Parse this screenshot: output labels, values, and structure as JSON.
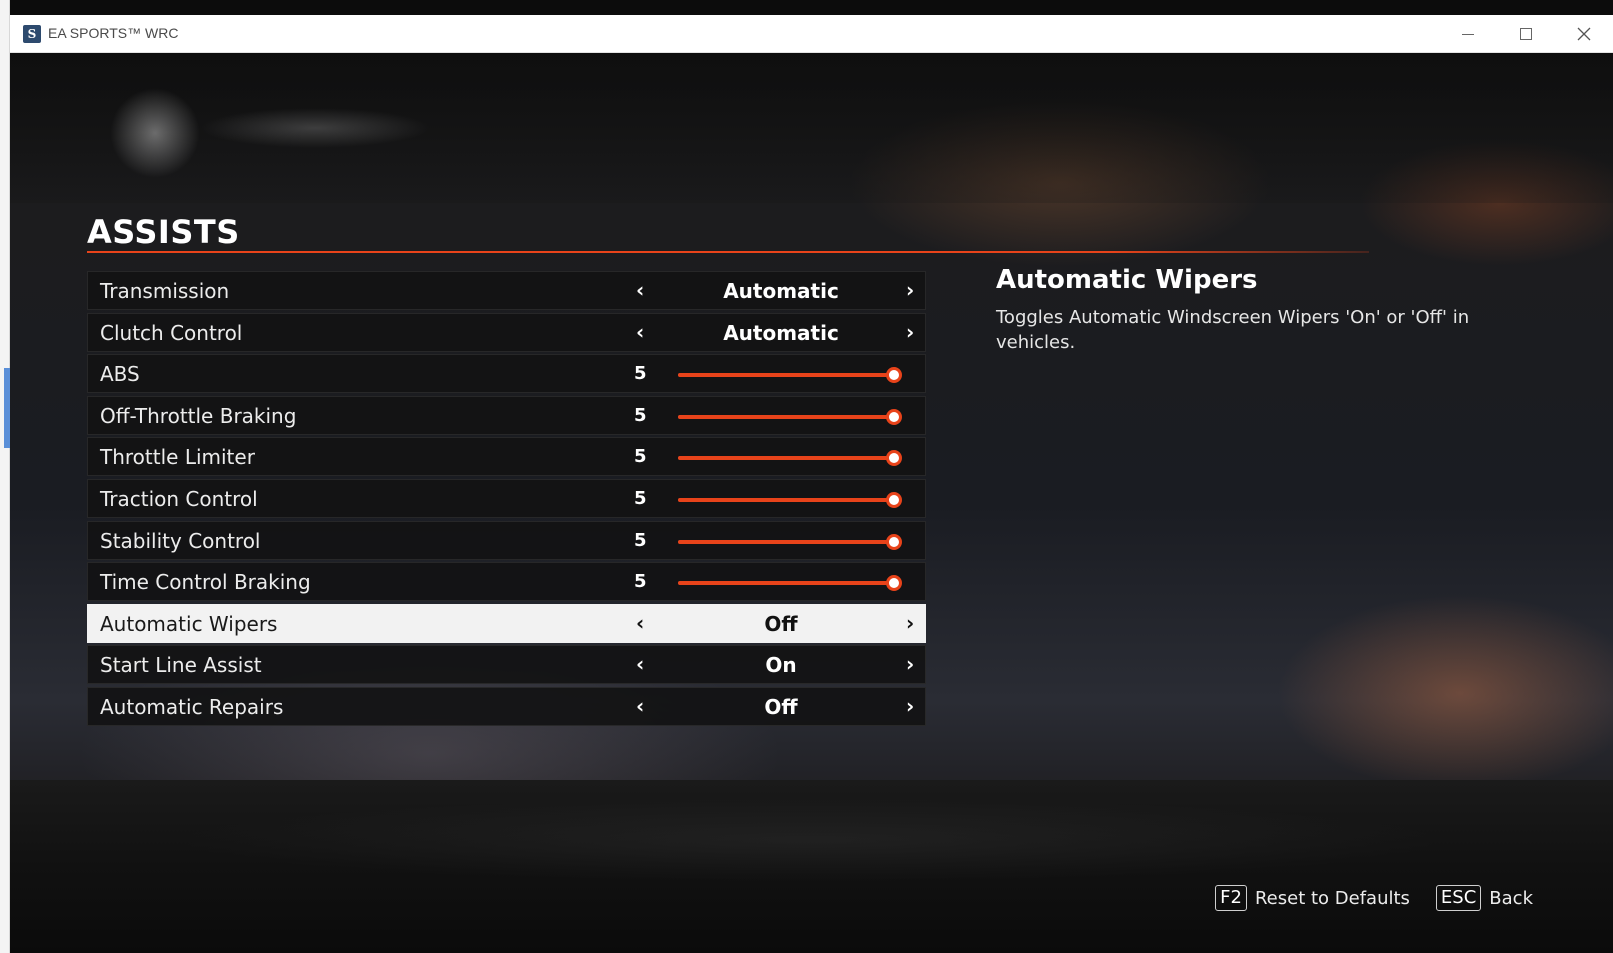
{
  "window": {
    "app_title": "EA SPORTS™ WRC"
  },
  "page": {
    "title": "ASSISTS"
  },
  "settings": [
    {
      "label": "Transmission",
      "kind": "option",
      "value": "Automatic"
    },
    {
      "label": "Clutch Control",
      "kind": "option",
      "value": "Automatic"
    },
    {
      "label": "ABS",
      "kind": "slider",
      "value": "5",
      "level": 1.0
    },
    {
      "label": "Off-Throttle Braking",
      "kind": "slider",
      "value": "5",
      "level": 1.0
    },
    {
      "label": "Throttle Limiter",
      "kind": "slider",
      "value": "5",
      "level": 1.0
    },
    {
      "label": "Traction Control",
      "kind": "slider",
      "value": "5",
      "level": 1.0
    },
    {
      "label": "Stability Control",
      "kind": "slider",
      "value": "5",
      "level": 1.0
    },
    {
      "label": "Time Control Braking",
      "kind": "slider",
      "value": "5",
      "level": 1.0
    },
    {
      "label": "Automatic Wipers",
      "kind": "option",
      "value": "Off",
      "selected": true
    },
    {
      "label": "Start Line Assist",
      "kind": "option",
      "value": "On"
    },
    {
      "label": "Automatic Repairs",
      "kind": "option",
      "value": "Off"
    }
  ],
  "arrows": {
    "left": "‹",
    "right": "›"
  },
  "description": {
    "title": "Automatic Wipers",
    "text": "Toggles Automatic Windscreen Wipers 'On' or 'Off' in vehicles."
  },
  "footer": {
    "reset_key": "F2",
    "reset_label": "Reset to Defaults",
    "back_key": "ESC",
    "back_label": "Back"
  },
  "colors": {
    "accent": "#e8431a",
    "row_bg": "#121214",
    "selected_row_bg": "#f2f2f2"
  },
  "icons": {
    "app": "ea-sports-wrc-icon",
    "minimize": "minimize-icon",
    "maximize": "maximize-icon",
    "close": "close-icon"
  }
}
